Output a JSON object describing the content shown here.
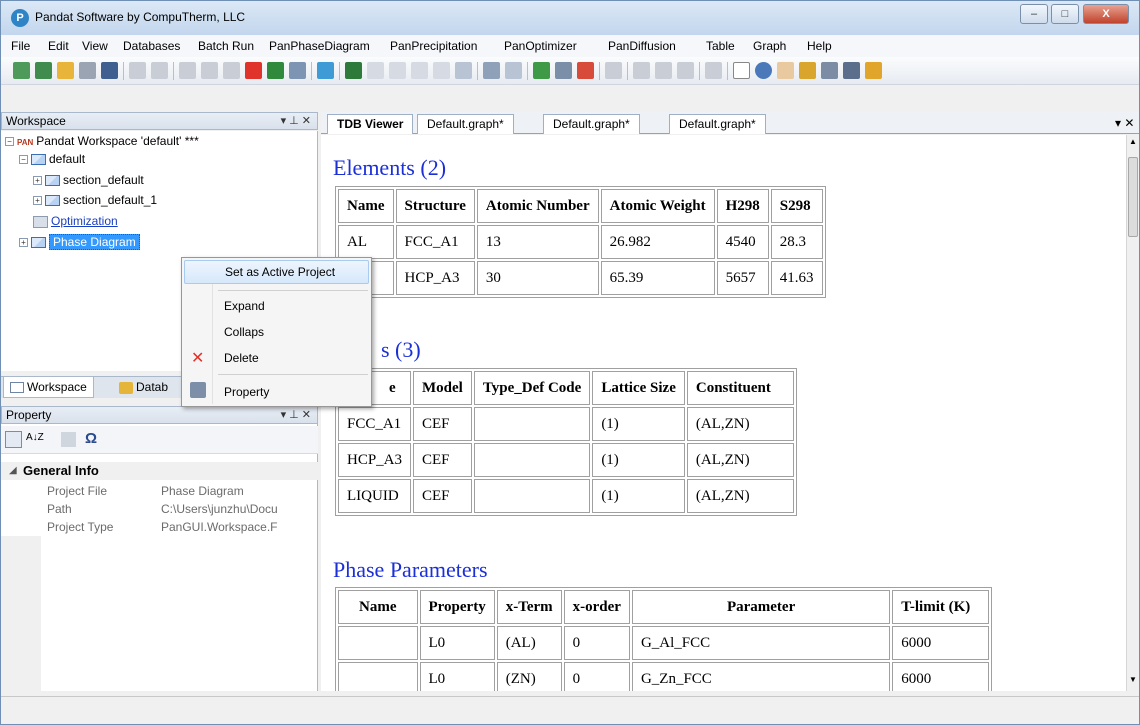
{
  "window": {
    "title": "Pandat Software by CompuTherm, LLC",
    "app_icon_letter": "P",
    "controls": [
      "–",
      "□",
      "X"
    ]
  },
  "menu": [
    "File",
    "Edit",
    "View",
    "Databases",
    "Batch Run",
    "PanPhaseDiagram",
    "PanPrecipitation",
    "PanOptimizer",
    "PanDiffusion",
    "Table",
    "Graph",
    "Help"
  ],
  "workspace": {
    "header": "Workspace",
    "pin_glyphs": "▾ ⊥ ✕",
    "root": "Pandat Workspace 'default' ***",
    "root_badge": "PAN",
    "items": [
      {
        "label": "default"
      },
      {
        "label": "section_default"
      },
      {
        "label": "section_default_1"
      },
      {
        "label": "Optimization"
      },
      {
        "label": "Phase Diagram"
      }
    ],
    "tabs": [
      "Workspace",
      "Datab"
    ]
  },
  "property": {
    "header": "Property",
    "sort_az": "A↓Z",
    "omega": "Ω",
    "category": "General Info",
    "rows": [
      {
        "key": "Project File",
        "value": "Phase Diagram"
      },
      {
        "key": "Path",
        "value": "C:\\Users\\junzhu\\Docu"
      },
      {
        "key": "Project Type",
        "value": "PanGUI.Workspace.F"
      }
    ]
  },
  "context_menu": {
    "items": [
      "Set as Active Project",
      "Expand",
      "Collaps",
      "Delete",
      "Property"
    ]
  },
  "doc_tabs": [
    "TDB Viewer",
    "Default.graph*",
    "Default.graph*",
    "Default.graph*"
  ],
  "doc_tabs_controls": "▾ ✕",
  "tdb": {
    "elements_title": "Elements (2)",
    "elements_headers": [
      "Name",
      "Structure",
      "Atomic Number",
      "Atomic Weight",
      "H298",
      "S298"
    ],
    "elements_rows": [
      [
        "AL",
        "FCC_A1",
        "13",
        "26.982",
        "4540",
        "28.3"
      ],
      [
        "",
        "HCP_A3",
        "30",
        "65.39",
        "5657",
        "41.63"
      ]
    ],
    "phases_title": "s (3)",
    "phases_headers": [
      "e",
      "Model",
      "Type_Def Code",
      "Lattice Size",
      "Constituent"
    ],
    "phases_rows": [
      [
        "FCC_A1",
        "CEF",
        "",
        "(1)",
        "(AL,ZN)"
      ],
      [
        "HCP_A3",
        "CEF",
        "",
        "(1)",
        "(AL,ZN)"
      ],
      [
        "LIQUID",
        "CEF",
        "",
        "(1)",
        "(AL,ZN)"
      ]
    ],
    "params_title": "Phase Parameters",
    "params_headers": [
      "Name",
      "Property",
      "x-Term",
      "x-order",
      "Parameter",
      "T-limit (K)"
    ],
    "params_rows": [
      [
        "",
        "L0",
        "(AL)",
        "0",
        "G_Al_FCC",
        "6000"
      ],
      [
        "",
        "L0",
        "(ZN)",
        "0",
        "G_Zn_FCC",
        "6000"
      ]
    ]
  }
}
